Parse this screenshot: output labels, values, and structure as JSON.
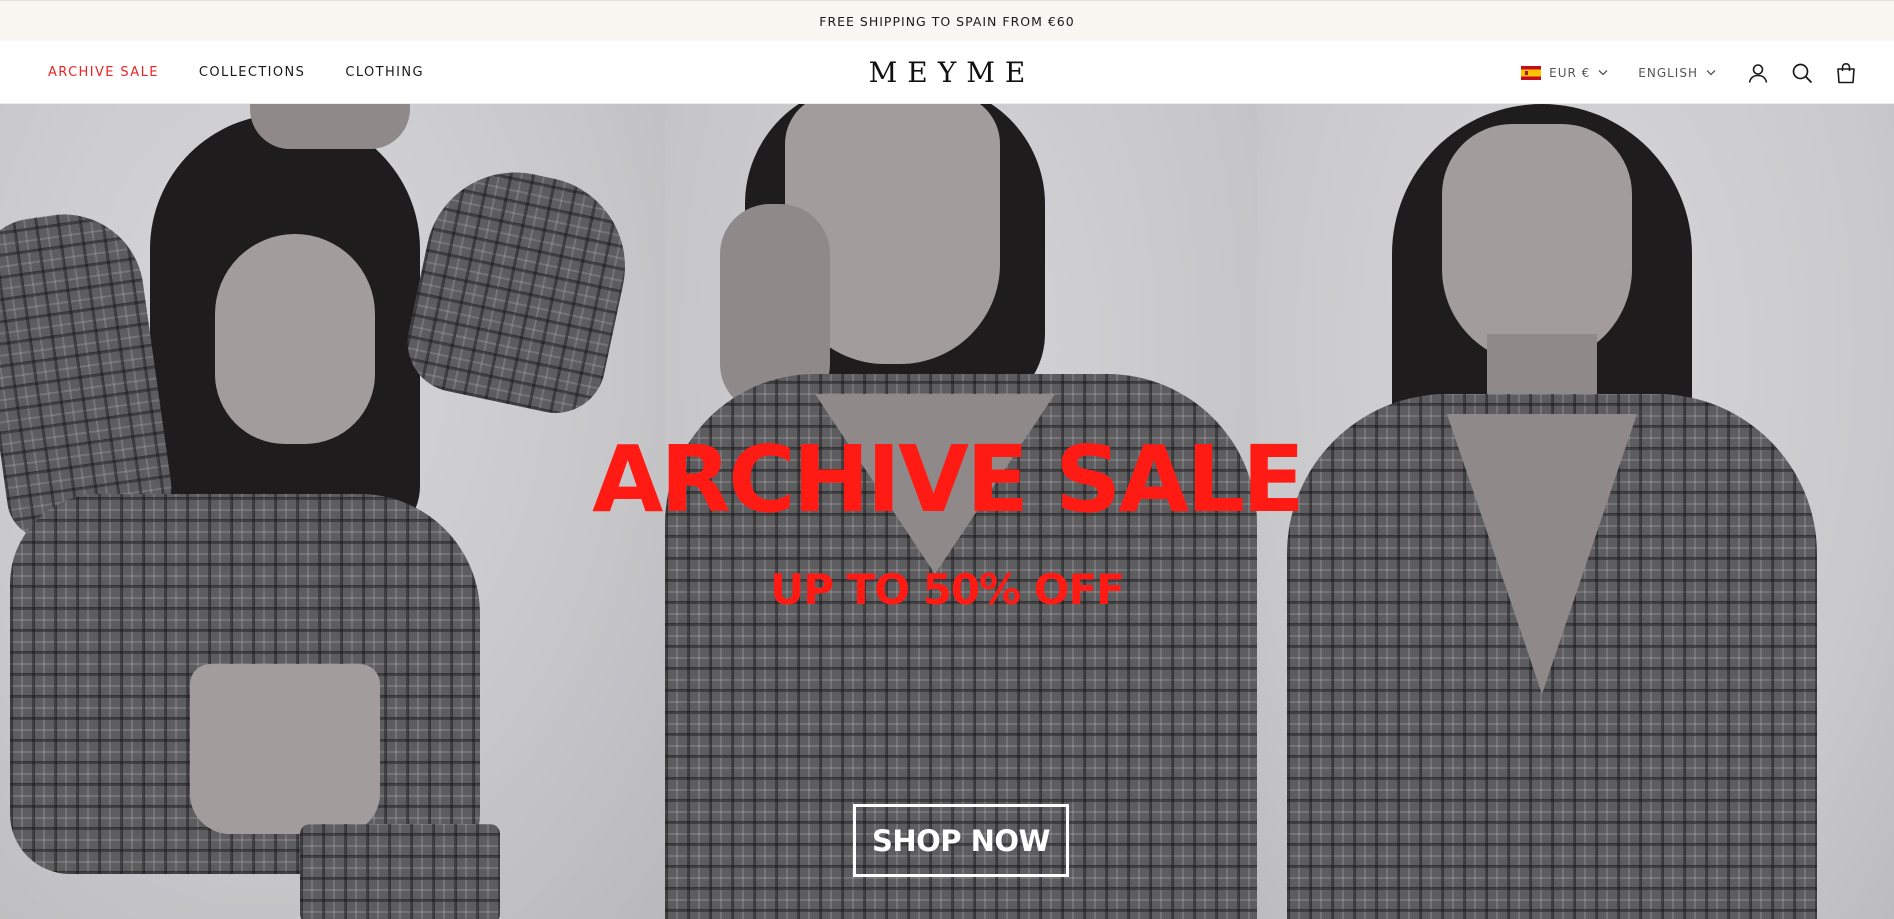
{
  "announcement": {
    "text": "FREE SHIPPING TO SPAIN FROM €60"
  },
  "header": {
    "nav": [
      {
        "label": "ARCHIVE SALE"
      },
      {
        "label": "COLLECTIONS"
      },
      {
        "label": "CLOTHING"
      }
    ],
    "logo": "MEYME",
    "currency": {
      "label": "EUR €",
      "flag": "spain-flag-icon"
    },
    "language": {
      "label": "ENGLISH"
    },
    "icons": [
      "account-icon",
      "search-icon",
      "cart-icon"
    ]
  },
  "hero": {
    "headline": "ARCHIVE SALE",
    "subheadline": "UP TO 50% OFF",
    "cta": "SHOP NOW"
  },
  "colors": {
    "sale_red": "#ee2323",
    "headline_red": "#ff1a14",
    "announcement_bg": "#f8f7f1"
  }
}
